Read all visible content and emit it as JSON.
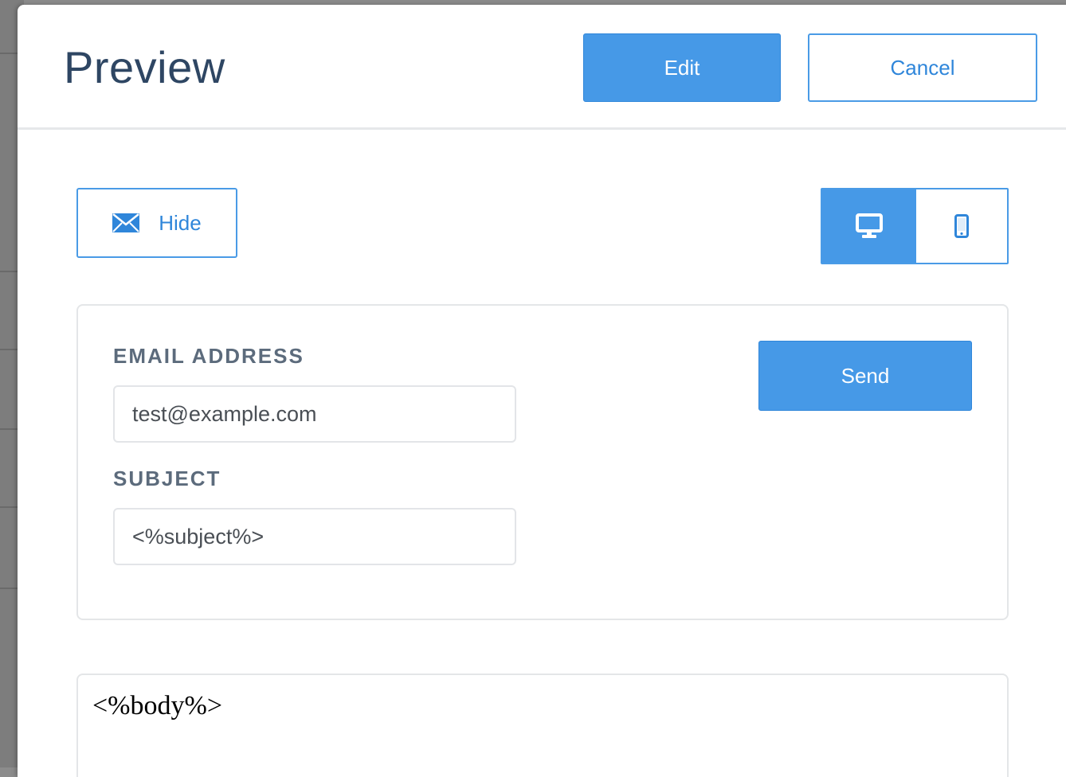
{
  "header": {
    "title": "Preview",
    "edit_label": "Edit",
    "cancel_label": "Cancel"
  },
  "toolbar": {
    "hide_label": "Hide",
    "hide_icon": "envelope-icon",
    "view_toggle": {
      "selected": "desktop",
      "options": [
        "desktop-monitor-icon",
        "mobile-phone-icon"
      ]
    }
  },
  "email_form": {
    "email_label": "EMAIL ADDRESS",
    "email_value": "test@example.com",
    "subject_label": "SUBJECT",
    "subject_value": "<%subject%>",
    "send_label": "Send"
  },
  "preview": {
    "body_text": "<%body%>"
  },
  "colors": {
    "accent": "#4699e7",
    "title": "#2e4663",
    "label": "#5c6b7c"
  }
}
